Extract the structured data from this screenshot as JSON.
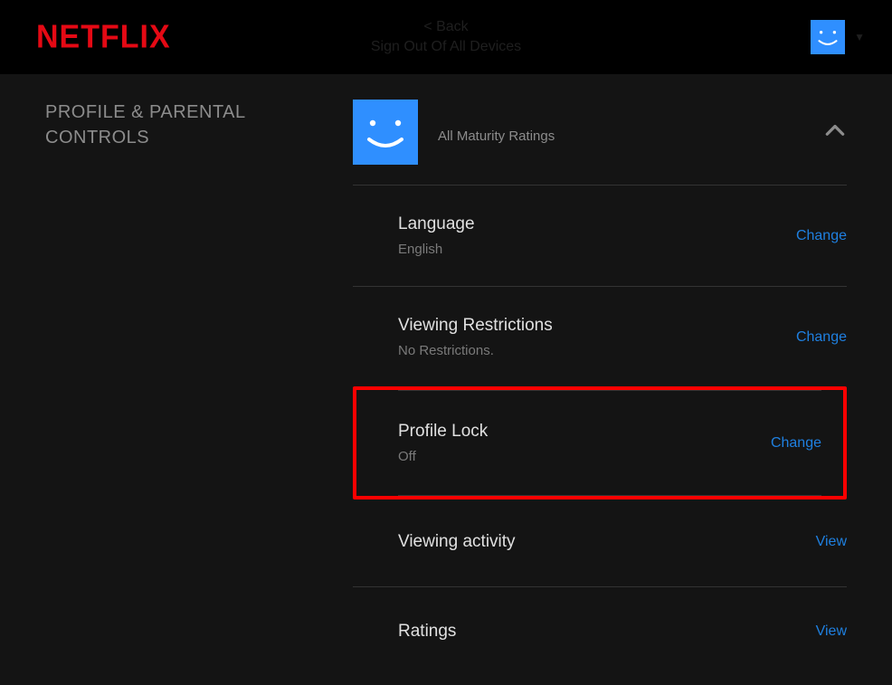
{
  "brand": "NETFLIX",
  "topbar": {
    "faded_line1": "< Back",
    "faded_line2": "Sign Out Of All Devices"
  },
  "section_title_line1": "PROFILE & PARENTAL",
  "section_title_line2": "CONTROLS",
  "profile": {
    "name": " ",
    "maturity": "All Maturity Ratings"
  },
  "settings": [
    {
      "title": "Language",
      "value": "English",
      "action": "Change"
    },
    {
      "title": "Viewing Restrictions",
      "value": "No Restrictions.",
      "action": "Change"
    },
    {
      "title": "Profile Lock",
      "value": "Off",
      "action": "Change"
    },
    {
      "title": "Viewing activity",
      "value": "",
      "action": "View"
    },
    {
      "title": "Ratings",
      "value": "",
      "action": "View"
    }
  ],
  "colors": {
    "brand": "#e50914",
    "link": "#1f80e0",
    "highlight": "#ff0000",
    "avatar": "#2f8fff"
  }
}
